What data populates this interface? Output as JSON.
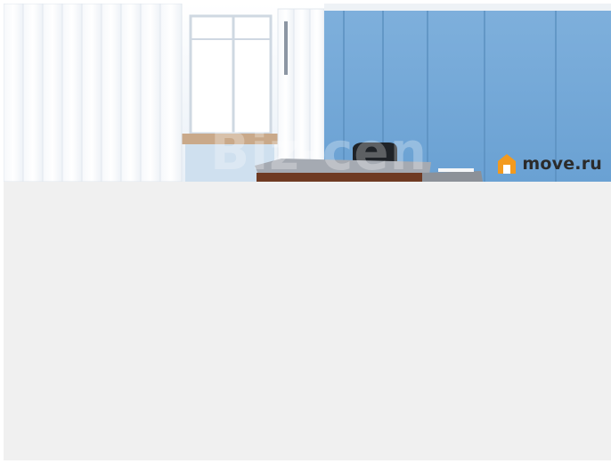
{
  "photo": {
    "description_icon": "office-room-photo",
    "watermark_text": "Biz-cen"
  },
  "brand": {
    "name": "move.ru",
    "icon": "house-icon",
    "accent_color": "#f39a1e"
  }
}
